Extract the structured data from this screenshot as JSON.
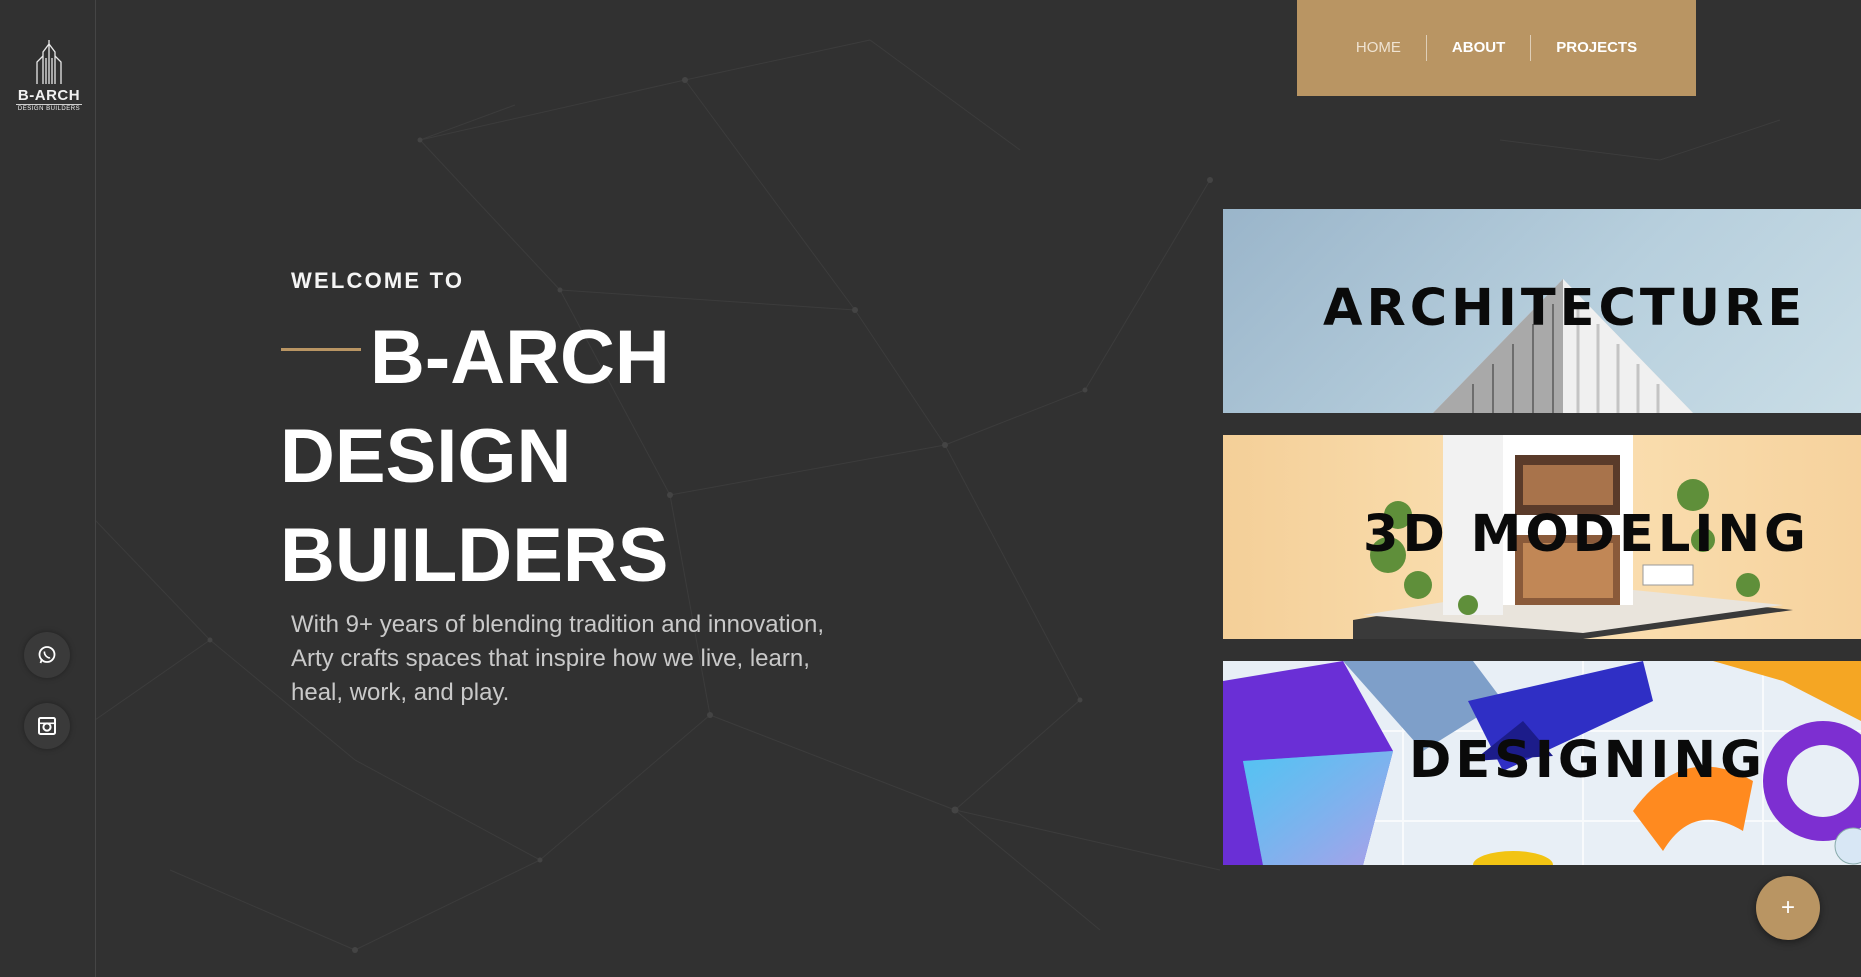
{
  "brand": {
    "logo_name": "B-ARCH",
    "logo_sub": "DESIGN BUILDERS",
    "accent_color": "#b99563",
    "background_color": "#313131"
  },
  "nav": {
    "items": [
      {
        "label": "HOME",
        "active": true
      },
      {
        "label": "ABOUT"
      },
      {
        "label": "PROJECTS"
      }
    ]
  },
  "hero": {
    "welcome": "WELCOME TO",
    "title_line1": "B-ARCH",
    "title_line2": "DESIGN",
    "title_line3": "BUILDERS",
    "description": "With 9+ years of blending tradition and innovation, Arty crafts spaces that inspire how we live, learn, heal, work, and play."
  },
  "services": [
    {
      "label": "ARCHITECTURE"
    },
    {
      "label": "3D MODELING"
    },
    {
      "label": "DESIGNING"
    }
  ],
  "social": {
    "items": [
      {
        "icon": "whatsapp-icon"
      },
      {
        "icon": "instagram-icon"
      }
    ]
  },
  "fab": {
    "label": "+"
  }
}
